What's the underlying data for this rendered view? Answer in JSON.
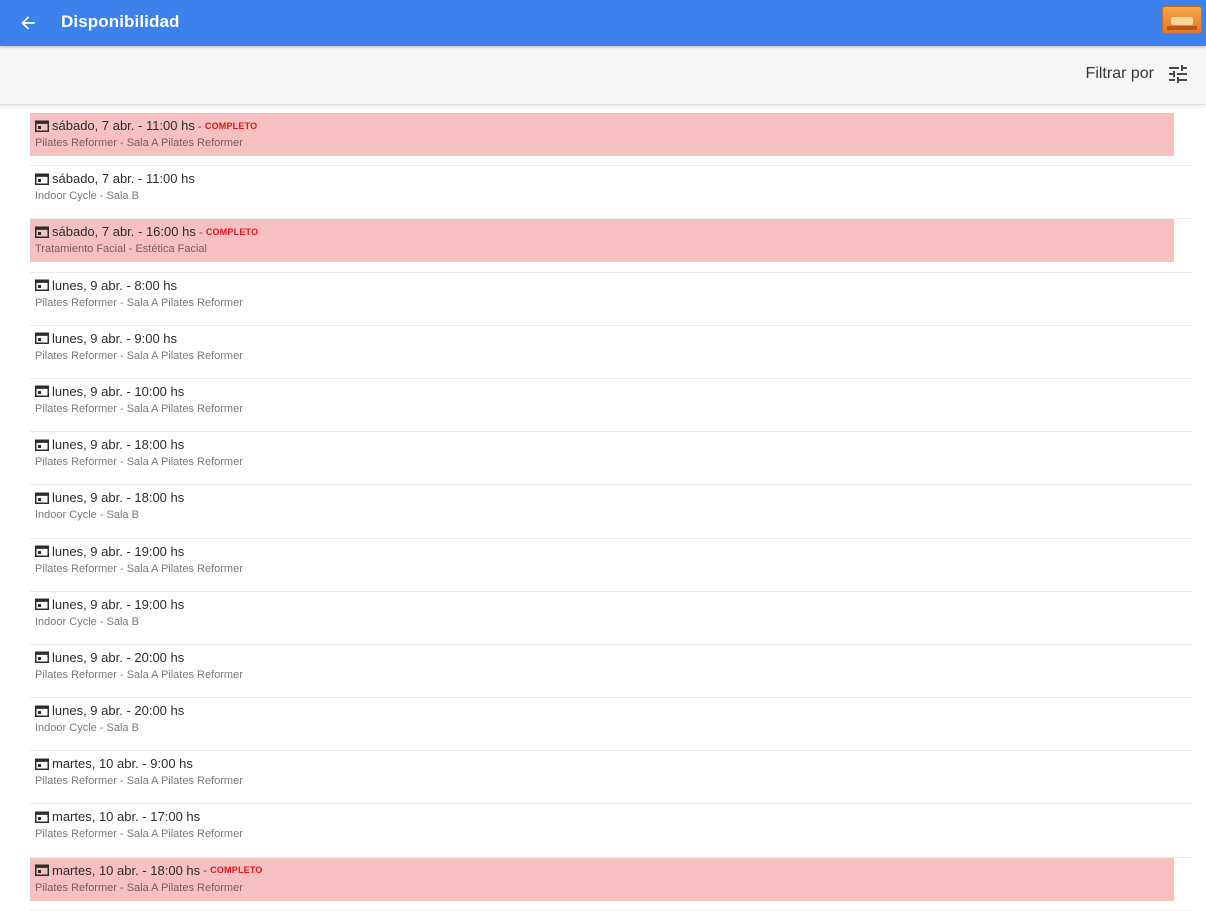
{
  "appbar": {
    "title": "Disponibilidad",
    "back_icon": "arrow-back-icon",
    "logo_icon": "app-logo",
    "color": "#3d82ec"
  },
  "filter": {
    "label": "Filtrar por",
    "icon": "tune-icon"
  },
  "colors": {
    "full_highlight": "#f6c0c0",
    "badge": "#e0141c"
  },
  "items": [
    {
      "when": "sábado, 7 abr. - 11:00 hs",
      "status": "COMPLETO",
      "detail": "Pilates Reformer - Sala A Pilates Reformer"
    },
    {
      "when": "sábado, 7 abr. - 11:00 hs",
      "status": "",
      "detail": "Indoor Cycle - Sala B"
    },
    {
      "when": "sábado, 7 abr. - 16:00 hs",
      "status": "COMPLETO",
      "detail": "Tratamiento Facial - Estética Facial"
    },
    {
      "when": "lunes, 9 abr. - 8:00 hs",
      "status": "",
      "detail": "Pilates Reformer - Sala A Pilates Reformer"
    },
    {
      "when": "lunes, 9 abr. - 9:00 hs",
      "status": "",
      "detail": "Pilates Reformer - Sala A Pilates Reformer"
    },
    {
      "when": "lunes, 9 abr. - 10:00 hs",
      "status": "",
      "detail": "Pilates Reformer - Sala A Pilates Reformer"
    },
    {
      "when": "lunes, 9 abr. - 18:00 hs",
      "status": "",
      "detail": "Pilates Reformer - Sala A Pilates Reformer"
    },
    {
      "when": "lunes, 9 abr. - 18:00 hs",
      "status": "",
      "detail": "Indoor Cycle - Sala B"
    },
    {
      "when": "lunes, 9 abr. - 19:00 hs",
      "status": "",
      "detail": "Pilates Reformer - Sala A Pilates Reformer"
    },
    {
      "when": "lunes, 9 abr. - 19:00 hs",
      "status": "",
      "detail": "Indoor Cycle - Sala B"
    },
    {
      "when": "lunes, 9 abr. - 20:00 hs",
      "status": "",
      "detail": "Pilates Reformer - Sala A Pilates Reformer"
    },
    {
      "when": "lunes, 9 abr. - 20:00 hs",
      "status": "",
      "detail": "Indoor Cycle - Sala B"
    },
    {
      "when": "martes, 10 abr. - 9:00 hs",
      "status": "",
      "detail": "Pilates Reformer - Sala A Pilates Reformer"
    },
    {
      "when": "martes, 10 abr. - 17:00 hs",
      "status": "",
      "detail": "Pilates Reformer - Sala A Pilates Reformer"
    },
    {
      "when": "martes, 10 abr. - 18:00 hs",
      "status": "COMPLETO",
      "detail": "Pilates Reformer - Sala A Pilates Reformer"
    }
  ]
}
